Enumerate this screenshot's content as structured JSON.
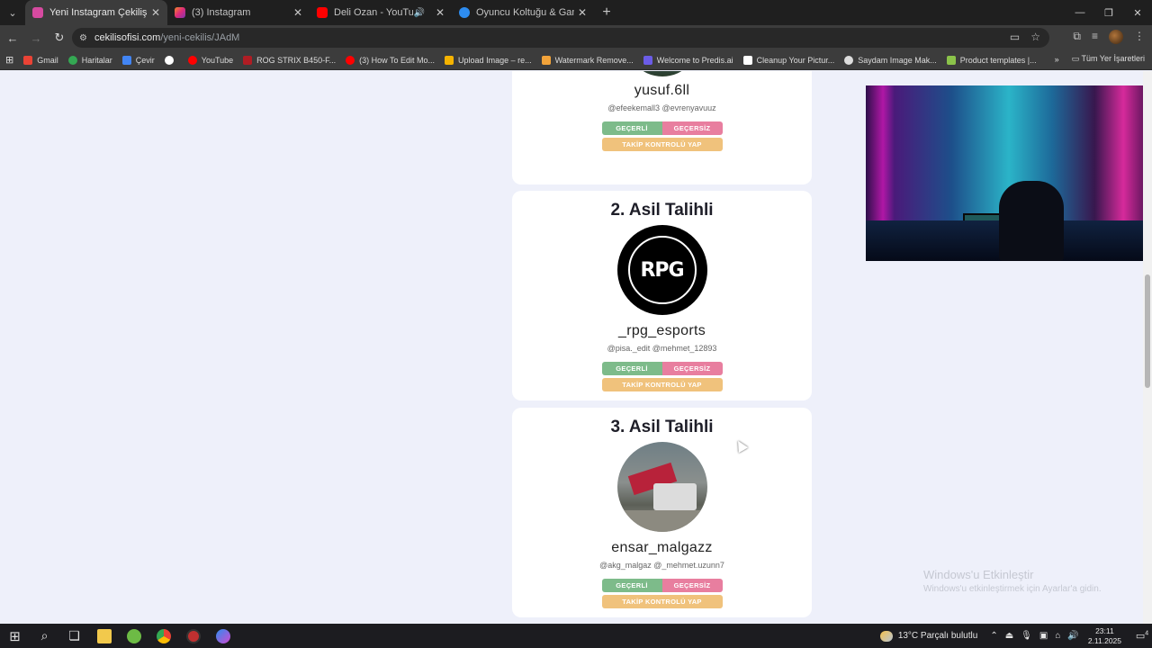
{
  "browser": {
    "tabs": [
      {
        "title": "Yeni Instagram Çekilişi - Çekiliş",
        "color": "#d64aa0",
        "active": true
      },
      {
        "title": "(3) Instagram",
        "color": "#e1306c",
        "active": false
      },
      {
        "title": "Deli Ozan - YouTube",
        "color": "#ff0000",
        "active": false,
        "audio": true
      },
      {
        "title": "Oyuncu Koltuğu & Gaming, Gam",
        "color": "#2d8cf0",
        "active": false
      }
    ],
    "url_host": "cekilisofisi.com",
    "url_path": "/yeni-cekilis/JAdM",
    "bookmarks": [
      {
        "label": "Gmail",
        "color": "#ea4335"
      },
      {
        "label": "Haritalar",
        "color": "#34a853"
      },
      {
        "label": "Çevir",
        "color": "#4285f4"
      },
      {
        "label": "",
        "color": "#ffffff"
      },
      {
        "label": "YouTube",
        "color": "#ff0000"
      },
      {
        "label": "ROG STRIX B450-F...",
        "color": "#b01d24"
      },
      {
        "label": "(3) How To Edit Mo...",
        "color": "#ff0000"
      },
      {
        "label": "Upload Image – re...",
        "color": "#f5b300"
      },
      {
        "label": "Watermark Remove...",
        "color": "#f2a33a"
      },
      {
        "label": "Welcome to Predis.ai",
        "color": "#6b5ce7"
      },
      {
        "label": "Cleanup Your Pictur...",
        "color": "#ffffff"
      },
      {
        "label": "Saydam Image Mak...",
        "color": "#dddddd"
      },
      {
        "label": "Product templates |...",
        "color": "#8bc34a"
      }
    ],
    "all_bookmarks": "Tüm Yer İşaretleri"
  },
  "winners": {
    "first": {
      "username": "yusuf.6ll",
      "tags": "@efeekemall3 @evrenyavuuz"
    },
    "second": {
      "rank": "2. Asil Talihli",
      "username": "_rpg_esports",
      "tags": "@pisa._edit @mehmet_12893",
      "logo_text": "RPG"
    },
    "third": {
      "rank": "3. Asil Talihli",
      "username": "ensar_malgazz",
      "tags": "@akg_malgaz @_mehmet.uzunn7"
    },
    "buttons": {
      "valid": "GEÇERLİ",
      "invalid": "GEÇERSİZ",
      "follow_check": "TAKİP KONTROLÜ YAP"
    }
  },
  "watermark": {
    "title": "Windows'u Etkinleştir",
    "subtitle": "Windows'u etkinleştirmek için Ayarlar'a gidin."
  },
  "taskbar": {
    "weather": "13°C  Parçalı bulutlu",
    "time": "23:11",
    "date": "2.11.2025",
    "notifications": "4"
  }
}
